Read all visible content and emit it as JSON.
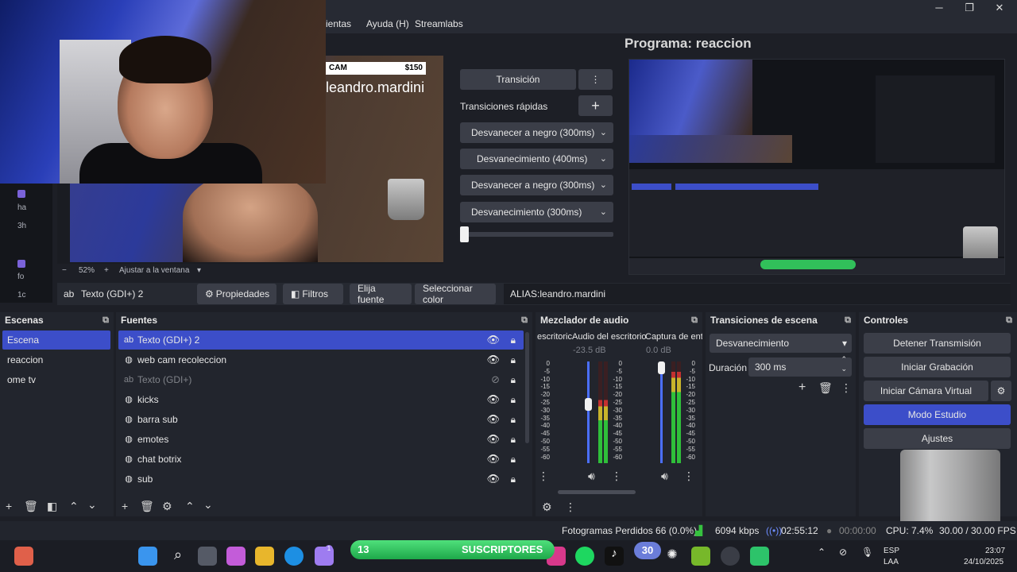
{
  "menu": {
    "items": [
      "ientas",
      "Ayuda (H)",
      "Streamlabs"
    ]
  },
  "window_controls": {
    "minimize": "─",
    "maximize": "❐",
    "close": "✕"
  },
  "preview": {
    "banner_left": "CAM",
    "banner_price": "$150",
    "alias_text": "leandro.mardini",
    "zoom": "52%",
    "zoom_plus": "+",
    "zoom_minus": "−",
    "fit_label": "Ajustar a la ventana",
    "chat_lines": [
      "ha",
      "3h",
      "fo",
      "1c"
    ]
  },
  "transitions": {
    "transition_button": "Transición",
    "quick_label": "Transiciones rápidas",
    "quick": [
      "Desvanecer a negro (300ms)",
      "Desvanecimiento (400ms)",
      "Desvanecer a negro (300ms)",
      "Desvanecimiento (300ms)"
    ]
  },
  "program": {
    "title": "Programa: reaccion"
  },
  "toolbar": {
    "selected_source": "Texto (GDI+) 2",
    "properties": "Propiedades",
    "filters": "Filtros",
    "choose_source": "Elija fuente",
    "select_color": "Seleccionar color",
    "alias_field": "ALIAS:leandro.mardini"
  },
  "scenes": {
    "title": "Escenas",
    "items": [
      "Escena",
      "reaccion",
      "ome tv"
    ],
    "selected_index": 0
  },
  "sources": {
    "title": "Fuentes",
    "items": [
      {
        "name": "Texto (GDI+) 2",
        "icon": "text-icon",
        "visible": true,
        "selected": true
      },
      {
        "name": "web cam recoleccion",
        "icon": "browser-icon",
        "visible": true,
        "selected": false
      },
      {
        "name": "Texto (GDI+)",
        "icon": "text-icon",
        "visible": false,
        "selected": false
      },
      {
        "name": "kicks",
        "icon": "browser-icon",
        "visible": true,
        "selected": false
      },
      {
        "name": "barra sub",
        "icon": "browser-icon",
        "visible": true,
        "selected": false
      },
      {
        "name": "emotes",
        "icon": "browser-icon",
        "visible": true,
        "selected": false
      },
      {
        "name": "chat botrix",
        "icon": "browser-icon",
        "visible": true,
        "selected": false
      },
      {
        "name": "sub",
        "icon": "browser-icon",
        "visible": true,
        "selected": false
      }
    ]
  },
  "mixer": {
    "title": "Mezclador de audio",
    "channels": [
      {
        "name": "escritoric",
        "db": ""
      },
      {
        "name": "Audio del escritorio",
        "db": "-23.5 dB",
        "level": 0.58
      },
      {
        "name": "Captura de entra",
        "db": "0.0 dB",
        "level": 0.94
      }
    ],
    "ticks": [
      "0",
      "-5",
      "-10",
      "-15",
      "-20",
      "-25",
      "-30",
      "-35",
      "-40",
      "-45",
      "-50",
      "-55",
      "-60"
    ]
  },
  "scene_transitions": {
    "title": "Transiciones de escena",
    "selected": "Desvanecimiento",
    "duration_label": "Duración",
    "duration_value": "300 ms"
  },
  "controls": {
    "title": "Controles",
    "stop_stream": "Detener Transmisión",
    "start_recording": "Iniciar Grabación",
    "start_virtual_cam": "Iniciar Cámara Virtual",
    "studio_mode": "Modo Estudio",
    "settings": "Ajustes"
  },
  "status": {
    "dropped_frames": "Fotogramas Perdidos 66 (0.0%)",
    "bitrate": "6094 kbps",
    "stream_time": "02:55:12",
    "rec_time": "00:00:00",
    "cpu": "CPU: 7.4%",
    "fps": "30.00 / 30.00 FPS"
  },
  "taskbar": {
    "sub_count": "13",
    "sub_label": "SUSCRIPTORES",
    "goal": "30",
    "lang": "ESP",
    "lang2": "LAA",
    "time": "23:07",
    "date": "24/10/2025",
    "badge": "1"
  },
  "colors": {
    "accent": "#3c4ec9",
    "panel": "#22252d",
    "button": "#3b3e48",
    "meter_green": "#2fbf3a",
    "meter_yellow": "#c9b42b",
    "meter_red": "#c33030",
    "sub_green": "#31c05a"
  }
}
